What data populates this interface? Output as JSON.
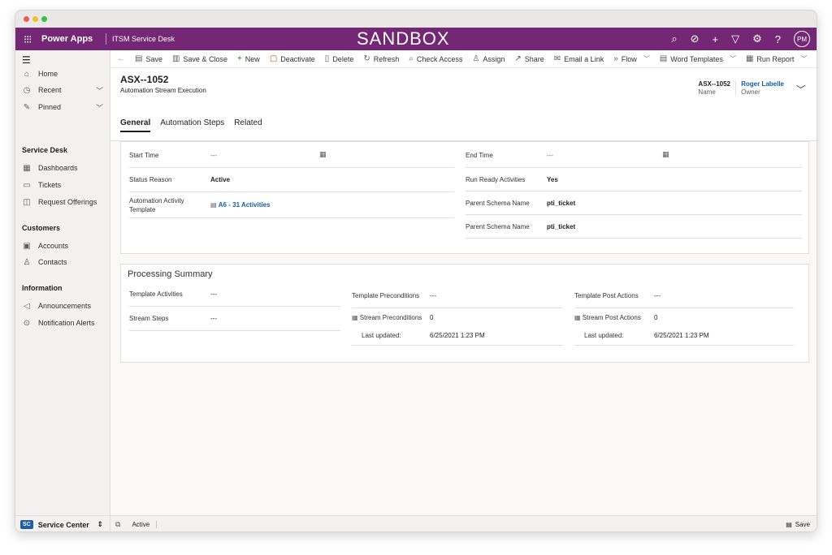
{
  "topbar": {
    "app_name": "Power Apps",
    "environment": "ITSM Service Desk",
    "banner": "SANDBOX",
    "avatar_initials": "PM",
    "color": "#742774"
  },
  "sidebar": {
    "top_items": [
      {
        "label": "Home",
        "icon": "home-icon"
      },
      {
        "label": "Recent",
        "icon": "clock-icon"
      },
      {
        "label": "Pinned",
        "icon": "pin-icon"
      }
    ],
    "groups": [
      {
        "heading": "Service Desk",
        "items": [
          {
            "label": "Dashboards",
            "icon": "dashboard-icon"
          },
          {
            "label": "Tickets",
            "icon": "ticket-icon"
          },
          {
            "label": "Request Offerings",
            "icon": "offering-icon"
          }
        ]
      },
      {
        "heading": "Customers",
        "items": [
          {
            "label": "Accounts",
            "icon": "accounts-icon"
          },
          {
            "label": "Contacts",
            "icon": "contact-icon"
          }
        ]
      },
      {
        "heading": "Information",
        "items": [
          {
            "label": "Announcements",
            "icon": "megaphone-icon"
          },
          {
            "label": "Notification Alerts",
            "icon": "alert-icon"
          }
        ]
      }
    ],
    "area": {
      "badge": "SC",
      "label": "Service Center"
    }
  },
  "commands": [
    {
      "label": "Save",
      "icon": "save-icon"
    },
    {
      "label": "Save & Close",
      "icon": "save-close-icon"
    },
    {
      "label": "New",
      "icon": "plus-icon"
    },
    {
      "label": "Deactivate",
      "icon": "deactivate-icon"
    },
    {
      "label": "Delete",
      "icon": "trash-icon"
    },
    {
      "label": "Refresh",
      "icon": "refresh-icon"
    },
    {
      "label": "Check Access",
      "icon": "check-access-icon"
    },
    {
      "label": "Assign",
      "icon": "assign-icon"
    },
    {
      "label": "Share",
      "icon": "share-icon"
    },
    {
      "label": "Email a Link",
      "icon": "email-icon"
    },
    {
      "label": "Flow",
      "icon": "flow-icon",
      "dropdown": true
    },
    {
      "label": "Word Templates",
      "icon": "word-icon",
      "dropdown": true
    },
    {
      "label": "Run Report",
      "icon": "report-icon",
      "dropdown": true
    }
  ],
  "record": {
    "title": "ASX--1052",
    "entity": "Automation Stream Execution",
    "name_value": "ASX--1052",
    "name_label": "Name",
    "owner_value": "Roger Labelle",
    "owner_label": "Owner"
  },
  "tabs": [
    "General",
    "Automation Steps",
    "Related"
  ],
  "general": {
    "start_time_label": "Start Time",
    "start_time_value": "---",
    "end_time_label": "End Time",
    "end_time_value": "---",
    "status_reason_label": "Status Reason",
    "status_reason_value": "Active",
    "run_ready_label": "Run Ready Activities",
    "run_ready_value": "Yes",
    "template_label": "Automation Activity Template",
    "template_value": "A6 - 31 Activities",
    "parent_schema_label_1": "Parent Schema Name",
    "parent_schema_value_1": "pti_ticket",
    "parent_schema_label_2": "Parent Schema Name",
    "parent_schema_value_2": "pti_ticket"
  },
  "processing": {
    "title": "Processing Summary",
    "template_activities_label": "Template Activities",
    "template_activities_value": "---",
    "stream_steps_label": "Stream Steps",
    "stream_steps_value": "---",
    "template_pre_label": "Template Preconditions",
    "template_pre_value": "---",
    "stream_pre_label": "Stream Preconditions",
    "stream_pre_value": "0",
    "last_updated_label_1": "Last updated:",
    "last_updated_value_1": "6/25/2021 1:23 PM",
    "template_post_label": "Template Post Actions",
    "template_post_value": "---",
    "stream_post_label": "Stream Post Actions",
    "stream_post_value": "0",
    "last_updated_label_2": "Last updated:",
    "last_updated_value_2": "6/25/2021 1:23 PM"
  },
  "status": {
    "state": "Active",
    "save_label": "Save"
  }
}
